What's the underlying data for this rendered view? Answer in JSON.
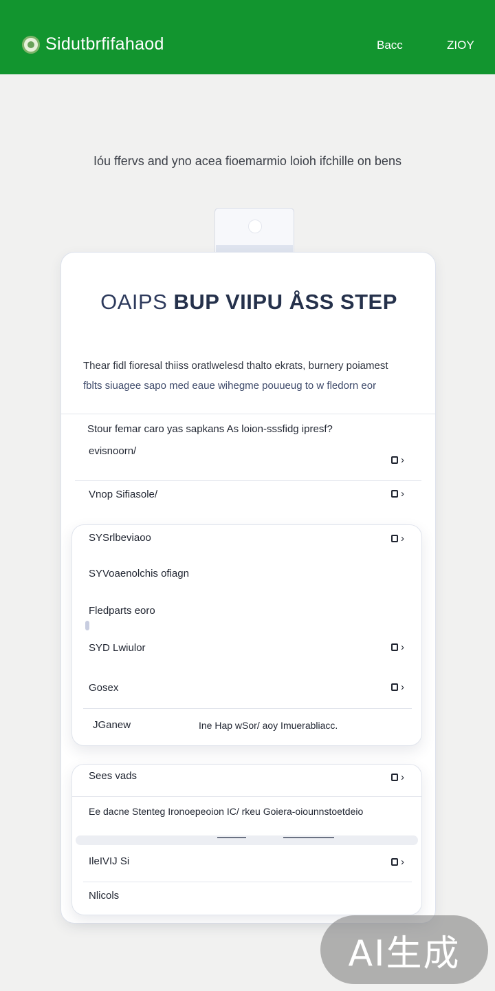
{
  "header": {
    "brand": "Sidutbrfifahaod",
    "link_1": "Bacc",
    "link_2": "ZIOY"
  },
  "intro": "Ióu ffervs and yno acea fioemarmio loioh ifchille on bens",
  "card": {
    "title_light": "OAIPS",
    "title_bold": "BUP VIIPU ÅSS STEP",
    "desc_line_1": "Thear fidl fioresal thiiss oratlwelesd thalto ekrats, burnery poiamest",
    "desc_line_2": "fblts siuagee sapo med eaue wihegme pouueug to w fledorn eor",
    "question": "Stour femar caro yas sapkans As loion-sssfidg ipresf?",
    "rows": [
      {
        "label": "evisnoorn/"
      },
      {
        "label": "Vnop Sifiasole/"
      }
    ]
  },
  "panel1": {
    "rows": [
      {
        "label": "SYSrlbeviaoo"
      },
      {
        "label": "SYVoaenolchis ofiagn"
      },
      {
        "label": "Fledparts eoro"
      },
      {
        "label": "SYD Lwiulor"
      },
      {
        "label": "Gosex"
      }
    ],
    "footer_label": "JGanew",
    "footer_text": "Ine Hap wSor/ aoy Imuerabliacc."
  },
  "panel2": {
    "rows": [
      {
        "label": "Sees vads"
      },
      {
        "label": "Ee dacne Stenteg Ironoepeoion IC/ rkeu Goiera-oiounnstoetdeio"
      },
      {
        "label": "IleIVIJ Si"
      },
      {
        "label": "Nlicols"
      }
    ]
  },
  "icons": {
    "brand": "logo-icon",
    "row_action": "chevron-right-icon"
  },
  "watermark": "AI生成",
  "colors": {
    "header": "#12952f",
    "background": "#f1f1f0",
    "card": "#ffffff",
    "title": "#25314b"
  }
}
